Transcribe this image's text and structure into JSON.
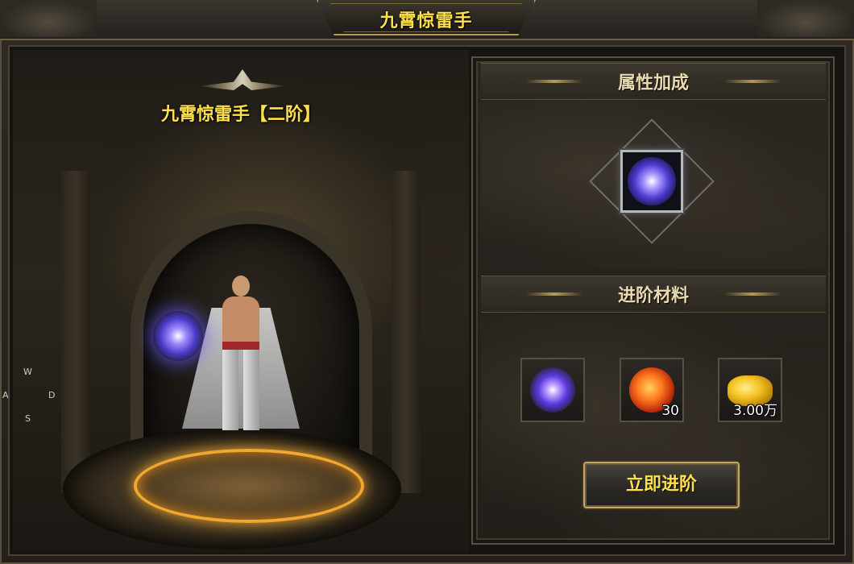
{
  "window": {
    "title": "九霄惊雷手"
  },
  "scene": {
    "title": "九霄惊雷手【二阶】",
    "keys": {
      "w": "W",
      "a": "A",
      "s": "S",
      "d": "D"
    }
  },
  "panel": {
    "attributes_title": "属性加成",
    "materials_title": "进阶材料",
    "materials": [
      {
        "icon": "lightning-spark-icon",
        "count": ""
      },
      {
        "icon": "fire-orb-icon",
        "count": "30"
      },
      {
        "icon": "gold-coins-icon",
        "count": "3.00万"
      }
    ],
    "advance_button": "立即进阶"
  },
  "colors": {
    "title_yellow": "#ffe04a",
    "section_text": "#e8d9b0",
    "gold_border": "#c7a85a"
  }
}
